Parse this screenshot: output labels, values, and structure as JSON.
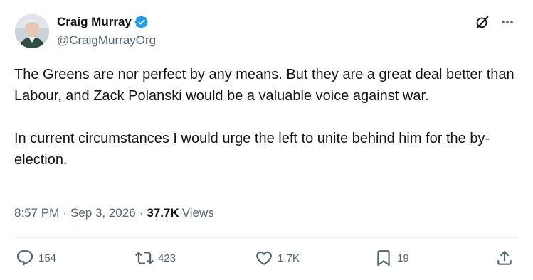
{
  "author": {
    "name": "Craig Murray",
    "handle": "@CraigMurrayOrg",
    "verified_color": "#1d9bf0"
  },
  "top_icons": [
    "grok-icon",
    "more-icon"
  ],
  "tweet": {
    "paragraphs": [
      "The Greens are nor perfect by any means. But they are a great deal better than Labour, and Zack Polanski would be a valuable voice against war.",
      "In current circumstances I would urge the left to unite behind him for the by-election."
    ]
  },
  "meta": {
    "time": "8:57 PM",
    "separator": "·",
    "date": "Sep 3, 2026",
    "views_count": "37.7K",
    "views_label": "Views"
  },
  "actions": {
    "replies": "154",
    "reposts": "423",
    "likes": "1.7K",
    "bookmarks": "19"
  },
  "colors": {
    "text": "#0f1419",
    "secondary": "#536471",
    "divider": "#eff3f4",
    "accent": "#1d9bf0"
  }
}
